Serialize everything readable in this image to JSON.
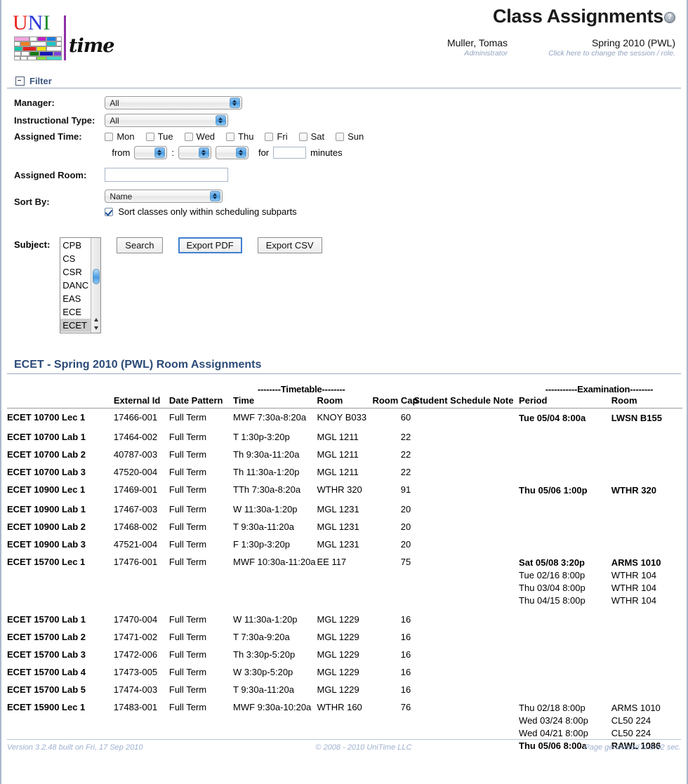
{
  "header": {
    "logo_uni": [
      "U",
      "N",
      "I"
    ],
    "logo_time": "time",
    "title": "Class Assignments",
    "help_icon": "?",
    "user_name": "Muller, Tomas",
    "user_role": "Administrator",
    "session": "Spring 2010 (PWL)",
    "session_hint": "Click here to change the session / role."
  },
  "filter": {
    "section_label": "Filter",
    "manager_label": "Manager:",
    "manager_value": "All",
    "instructional_type_label": "Instructional Type:",
    "instructional_type_value": "All",
    "assigned_time_label": "Assigned Time:",
    "days": [
      {
        "label": "Mon",
        "checked": false
      },
      {
        "label": "Tue",
        "checked": false
      },
      {
        "label": "Wed",
        "checked": false
      },
      {
        "label": "Thu",
        "checked": false
      },
      {
        "label": "Fri",
        "checked": false
      },
      {
        "label": "Sat",
        "checked": false
      },
      {
        "label": "Sun",
        "checked": false
      }
    ],
    "from_label": "from",
    "time_hour": "",
    "time_colon": ":",
    "time_minute": "",
    "time_ampm": "",
    "for_label": "for",
    "duration_value": "",
    "minutes_label": "minutes",
    "assigned_room_label": "Assigned Room:",
    "assigned_room_value": "",
    "sort_by_label": "Sort By:",
    "sort_by_value": "Name",
    "sort_subparts_label": "Sort classes only within scheduling subparts",
    "sort_subparts_checked": true,
    "subject_label": "Subject:",
    "subjects": [
      "CPB",
      "CS",
      "CSR",
      "DANC",
      "EAS",
      "ECE",
      "ECET"
    ],
    "subject_selected": "ECET",
    "buttons": {
      "search": "Search",
      "export_pdf": "Export PDF",
      "export_csv": "Export CSV"
    }
  },
  "results": {
    "title": "ECET - Spring 2010 (PWL) Room Assignments",
    "group_timetable": "--------Timetable--------",
    "group_examination": "-----------Examination--------",
    "columns": {
      "name": "",
      "external_id": "External Id",
      "date_pattern": "Date Pattern",
      "time": "Time",
      "room": "Room",
      "room_cap": "Room Cap",
      "note": "Student Schedule Note",
      "exam_period": "Period",
      "exam_room": "Room"
    },
    "rows": [
      {
        "name": "ECET 10700 Lec 1",
        "external_id": "17466-001",
        "date_pattern": "Full Term",
        "time": "MWF 7:30a-8:20a",
        "room": "KNOY B033",
        "room_cap": "60",
        "note": "",
        "exams": [
          {
            "period": "Tue 05/04 8:00a",
            "room": "LWSN B155",
            "final": true
          }
        ]
      },
      {
        "name": "ECET 10700 Lab 1",
        "external_id": "17464-002",
        "date_pattern": "Full Term",
        "time": "T 1:30p-3:20p",
        "room": "MGL 1211",
        "room_cap": "22",
        "note": "",
        "exams": []
      },
      {
        "name": "ECET 10700 Lab 2",
        "external_id": "40787-003",
        "date_pattern": "Full Term",
        "time": "Th 9:30a-11:20a",
        "room": "MGL 1211",
        "room_cap": "22",
        "note": "",
        "exams": []
      },
      {
        "name": "ECET 10700 Lab 3",
        "external_id": "47520-004",
        "date_pattern": "Full Term",
        "time": "Th 11:30a-1:20p",
        "room": "MGL 1211",
        "room_cap": "22",
        "note": "",
        "exams": []
      },
      {
        "name": "ECET 10900 Lec 1",
        "external_id": "17469-001",
        "date_pattern": "Full Term",
        "time": "TTh 7:30a-8:20a",
        "room": "WTHR 320",
        "room_cap": "91",
        "note": "",
        "exams": [
          {
            "period": "Thu 05/06 1:00p",
            "room": "WTHR 320",
            "final": true
          }
        ]
      },
      {
        "name": "ECET 10900 Lab 1",
        "external_id": "17467-003",
        "date_pattern": "Full Term",
        "time": "W 11:30a-1:20p",
        "room": "MGL 1231",
        "room_cap": "20",
        "note": "",
        "exams": []
      },
      {
        "name": "ECET 10900 Lab 2",
        "external_id": "17468-002",
        "date_pattern": "Full Term",
        "time": "T 9:30a-11:20a",
        "room": "MGL 1231",
        "room_cap": "20",
        "note": "",
        "exams": []
      },
      {
        "name": "ECET 10900 Lab 3",
        "external_id": "47521-004",
        "date_pattern": "Full Term",
        "time": "F 1:30p-3:20p",
        "room": "MGL 1231",
        "room_cap": "20",
        "note": "",
        "exams": []
      },
      {
        "name": "ECET 15700 Lec 1",
        "external_id": "17476-001",
        "date_pattern": "Full Term",
        "time": "MWF 10:30a-11:20a",
        "room": "EE 117",
        "room_cap": "75",
        "note": "",
        "exams": [
          {
            "period": "Sat 05/08 3:20p",
            "room": "ARMS 1010",
            "final": true
          },
          {
            "period": "Tue 02/16 8:00p",
            "room": "WTHR 104",
            "final": false
          },
          {
            "period": "Thu 03/04 8:00p",
            "room": "WTHR 104",
            "final": false
          },
          {
            "period": "Thu 04/15 8:00p",
            "room": "WTHR 104",
            "final": false
          }
        ]
      },
      {
        "name": "ECET 15700 Lab 1",
        "external_id": "17470-004",
        "date_pattern": "Full Term",
        "time": "W 11:30a-1:20p",
        "room": "MGL 1229",
        "room_cap": "16",
        "note": "",
        "exams": []
      },
      {
        "name": "ECET 15700 Lab 2",
        "external_id": "17471-002",
        "date_pattern": "Full Term",
        "time": "T 7:30a-9:20a",
        "room": "MGL 1229",
        "room_cap": "16",
        "note": "",
        "exams": []
      },
      {
        "name": "ECET 15700 Lab 3",
        "external_id": "17472-006",
        "date_pattern": "Full Term",
        "time": "Th 3:30p-5:20p",
        "room": "MGL 1229",
        "room_cap": "16",
        "note": "",
        "exams": []
      },
      {
        "name": "ECET 15700 Lab 4",
        "external_id": "17473-005",
        "date_pattern": "Full Term",
        "time": "W 3:30p-5:20p",
        "room": "MGL 1229",
        "room_cap": "16",
        "note": "",
        "exams": []
      },
      {
        "name": "ECET 15700 Lab 5",
        "external_id": "17474-003",
        "date_pattern": "Full Term",
        "time": "T 9:30a-11:20a",
        "room": "MGL 1229",
        "room_cap": "16",
        "note": "",
        "exams": []
      },
      {
        "name": "ECET 15900 Lec 1",
        "external_id": "17483-001",
        "date_pattern": "Full Term",
        "time": "MWF 9:30a-10:20a",
        "room": "WTHR 160",
        "room_cap": "76",
        "note": "",
        "exams": [
          {
            "period": "Thu 02/18 8:00p",
            "room": "ARMS 1010",
            "final": false
          },
          {
            "period": "Wed 03/24 8:00p",
            "room": "CL50 224",
            "final": false
          },
          {
            "period": "Wed 04/21 8:00p",
            "room": "CL50 224",
            "final": false
          },
          {
            "period": "Thu 05/06 8:00a",
            "room": "RAWL 1086",
            "final": true
          }
        ]
      }
    ]
  },
  "footer": {
    "version": "Version 3.2.48 built on Fri, 17 Sep 2010",
    "copyright": "© 2008 - 2010 UniTime LLC",
    "generated": "Page generated in 5.52 sec."
  }
}
